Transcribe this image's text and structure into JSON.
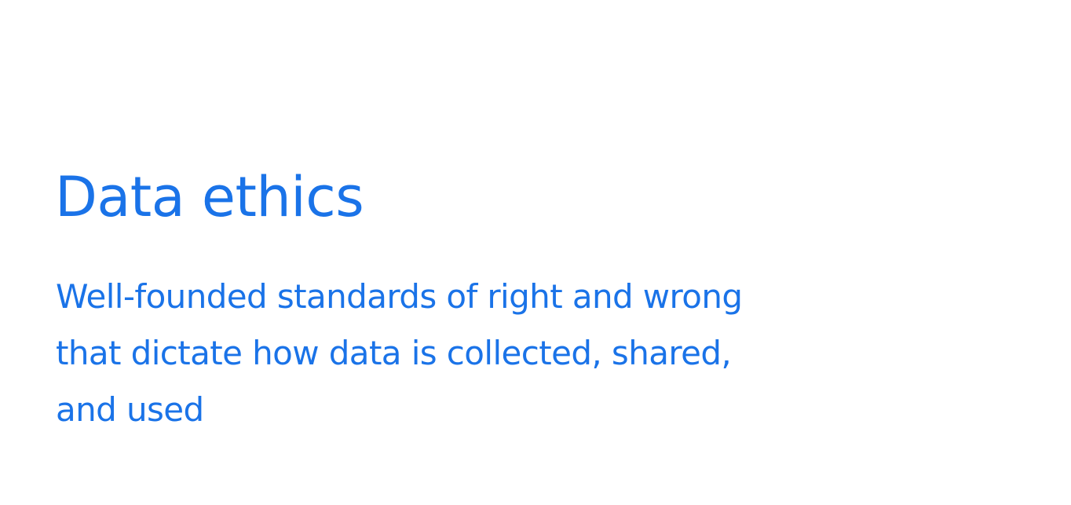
{
  "slide": {
    "title": "Data ethics",
    "definition_lines": [
      "Well-founded standards of right and wrong",
      "that dictate how data is collected, shared,",
      "and used"
    ],
    "text_color": "#1a73e8",
    "background_color": "#ffffff"
  }
}
